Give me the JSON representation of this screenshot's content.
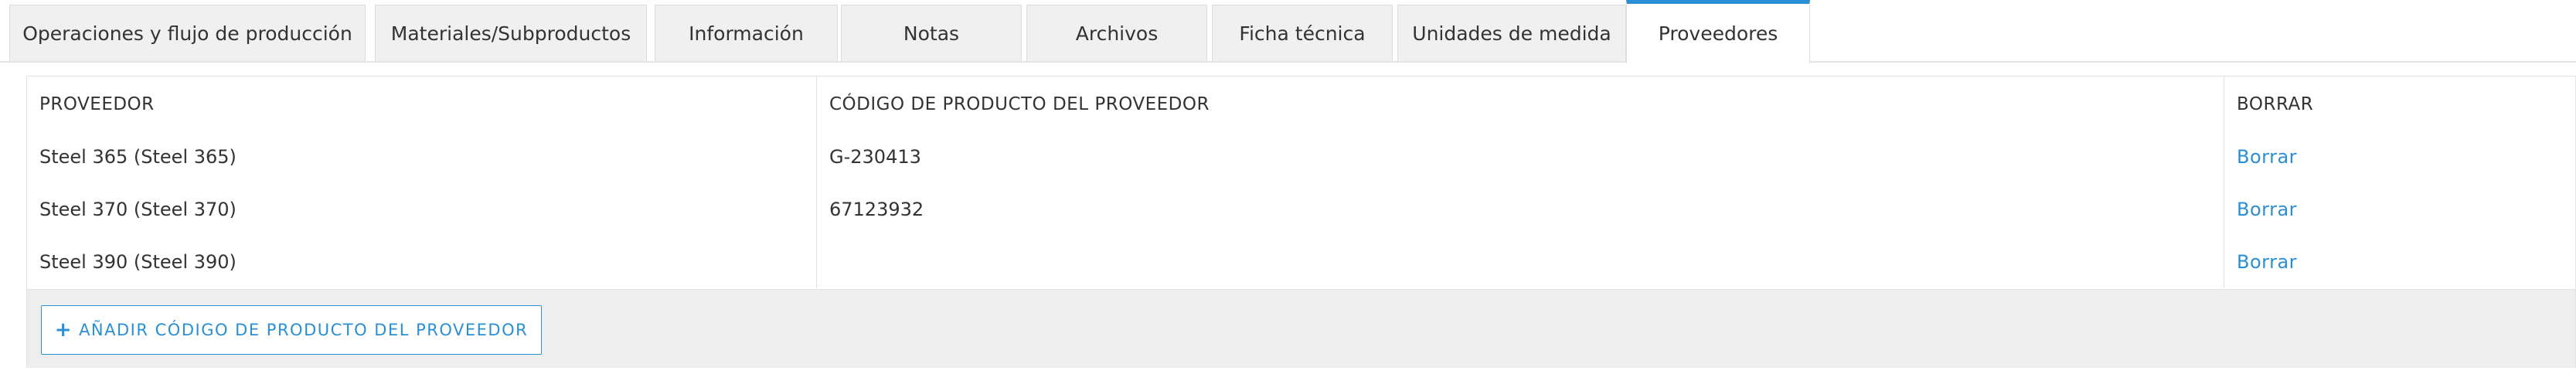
{
  "tabs": [
    {
      "label": "Operaciones y flujo de producción"
    },
    {
      "label": "Materiales/Subproductos"
    },
    {
      "label": "Información"
    },
    {
      "label": "Notas"
    },
    {
      "label": "Archivos"
    },
    {
      "label": "Ficha técnica"
    },
    {
      "label": "Unidades de medida"
    },
    {
      "label": "Proveedores"
    }
  ],
  "active_tab": "Proveedores",
  "table": {
    "headers": {
      "supplier": "PROVEEDOR",
      "code": "CÓDIGO DE PRODUCTO DEL PROVEEDOR",
      "delete": "BORRAR"
    },
    "rows": [
      {
        "supplier": "Steel 365 (Steel 365)",
        "code": "G-230413",
        "delete": "Borrar"
      },
      {
        "supplier": "Steel 370 (Steel 370)",
        "code": "67123932",
        "delete": "Borrar"
      },
      {
        "supplier": "Steel 390 (Steel 390)",
        "code": "",
        "delete": "Borrar"
      }
    ]
  },
  "footer": {
    "plus_icon": "+",
    "add_label": "AÑADIR CÓDIGO DE PRODUCTO DEL PROVEEDOR"
  },
  "colors": {
    "accent": "#2a8fd4",
    "tab_bg": "#f0f0f0",
    "footer_bg": "#eeeeee"
  }
}
